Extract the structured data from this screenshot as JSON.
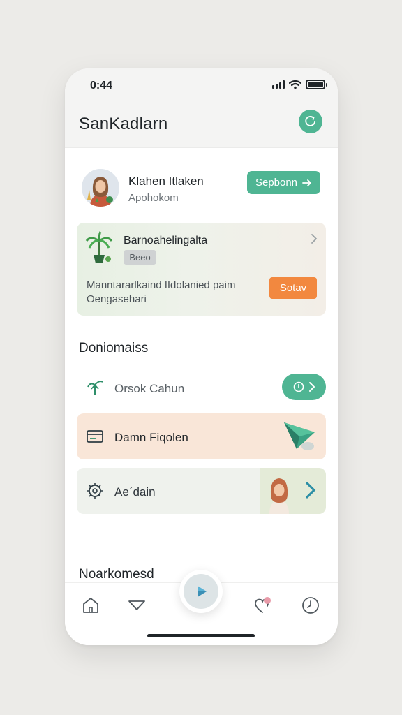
{
  "status_bar": {
    "time": "0:44"
  },
  "header": {
    "title": "SanKadlarn",
    "action_icon": "refresh-icon"
  },
  "profile": {
    "name": "Klahen Itlaken",
    "subtitle": "Apohokom",
    "button_label": "Sepbonn"
  },
  "promo": {
    "title": "Barnoahelingalta",
    "chip": "Beeo",
    "description_line1": "Manntararlkaind IIdolanied paim",
    "description_line2": "Oengasehari",
    "button_label": "Sotav"
  },
  "section": {
    "title": "Doniomaiss",
    "items": [
      {
        "label": "Orsok Cahun",
        "icon": "sprout-icon"
      },
      {
        "label": "Damn Fiqolen",
        "icon": "card-icon"
      },
      {
        "label": "Aeˊdain",
        "icon": "gear-icon"
      }
    ]
  },
  "section2": {
    "title": "Noarkomesd"
  },
  "nav": {
    "items": [
      "home-icon",
      "triangle-icon",
      "play-icon",
      "heart-icon",
      "clock-icon"
    ]
  },
  "colors": {
    "accent": "#4fb593",
    "orange": "#f2883f",
    "peach": "#f9e6d8",
    "background": "#ecebe8"
  }
}
